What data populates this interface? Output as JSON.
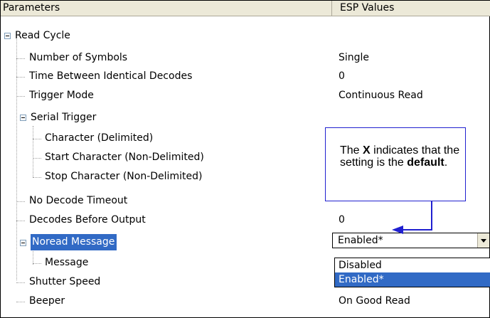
{
  "header": {
    "params_label": "Parameters",
    "values_label": "ESP Values"
  },
  "tree": [
    {
      "label": "Read Cycle",
      "value": ""
    },
    {
      "label": "Number of Symbols",
      "value": "Single"
    },
    {
      "label": "Time Between Identical Decodes",
      "value": "0"
    },
    {
      "label": "Trigger Mode",
      "value": "Continuous Read"
    },
    {
      "label": "Serial Trigger",
      "value": ""
    },
    {
      "label": "Character (Delimited)",
      "value": ""
    },
    {
      "label": "Start Character (Non-Delimited)",
      "value": ""
    },
    {
      "label": "Stop Character (Non-Delimited)",
      "value": ""
    },
    {
      "label": "No Decode Timeout",
      "value": ""
    },
    {
      "label": "Decodes Before Output",
      "value": "0"
    },
    {
      "label": "Noread Message",
      "value": ""
    },
    {
      "label": "Message",
      "value": ""
    },
    {
      "label": "Shutter Speed",
      "value": ""
    },
    {
      "label": "Beeper",
      "value": "On Good Read"
    }
  ],
  "combo": {
    "selected": "Enabled*",
    "options": [
      "Disabled",
      "Enabled*"
    ],
    "highlighted_option": "Enabled*"
  },
  "callout": {
    "part1": "The ",
    "x_mark": "X",
    "part2": " indicates that the setting is the ",
    "default_word": "default",
    "part3": "."
  },
  "colors": {
    "selection": "#316ac5",
    "callout_border": "#2020d0",
    "header_bg": "#ece9d8"
  }
}
